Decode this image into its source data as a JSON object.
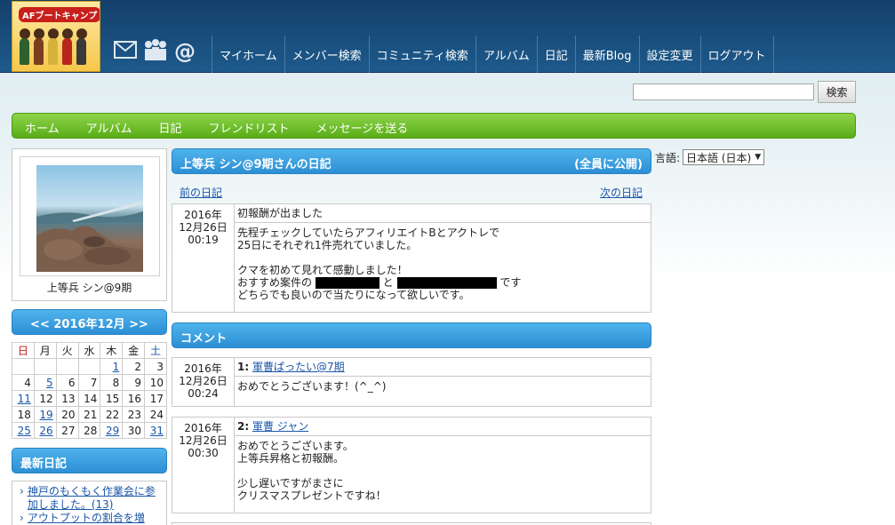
{
  "header": {
    "logo_text": "AFブートキャンプ",
    "icons": [
      "mail-icon",
      "members-icon",
      "at-icon"
    ],
    "nav": [
      "マイホーム",
      "メンバー検索",
      "コミュニティ検索",
      "アルバム",
      "日記",
      "最新Blog",
      "設定変更",
      "ログアウト"
    ]
  },
  "search": {
    "placeholder": "",
    "button": "検索"
  },
  "subnav": [
    "ホーム",
    "アルバム",
    "日記",
    "フレンドリスト",
    "メッセージを送る"
  ],
  "lang": {
    "label": "言語:",
    "selected": "日本語 (日本)"
  },
  "profile": {
    "name": "上等兵 シン@9期"
  },
  "calendar": {
    "title": "<< 2016年12月 >>",
    "dow": [
      "日",
      "月",
      "火",
      "水",
      "木",
      "金",
      "土"
    ],
    "weeks": [
      [
        "",
        "",
        "",
        "",
        "1",
        "2",
        "3"
      ],
      [
        "4",
        "5",
        "6",
        "7",
        "8",
        "9",
        "10"
      ],
      [
        "11",
        "12",
        "13",
        "14",
        "15",
        "16",
        "17"
      ],
      [
        "18",
        "19",
        "20",
        "21",
        "22",
        "23",
        "24"
      ],
      [
        "25",
        "26",
        "27",
        "28",
        "29",
        "30",
        "31"
      ]
    ],
    "linked_days": [
      "1",
      "5",
      "11",
      "19",
      "25",
      "26",
      "29",
      "31"
    ]
  },
  "recent": {
    "title": "最新日記",
    "items": [
      "神戸のもくもく作業会に参加しました。(13)",
      "アウトプットの割合を増"
    ]
  },
  "diary": {
    "title": "上等兵 シン@9期さんの日記",
    "visibility": "(全員に公開)",
    "prev": "前の日記",
    "next": "次の日記",
    "date": [
      "2016年",
      "12月26日",
      "00:19"
    ],
    "subject": "初報酬が出ました",
    "body_line1": "先程チェックしていたらアフィリエイトBとアクトレで",
    "body_line2": "25日にそれぞれ1件売れていました。",
    "body_line3": "クマを初めて見れて感動しました！",
    "body_line4a": "おすすめ案件の",
    "body_line4b": "と",
    "body_line4c": "です",
    "body_line5": "どちらでも良いので当たりになって欲しいです。"
  },
  "comments": {
    "title": "コメント",
    "items": [
      {
        "num": "1:",
        "author": "軍曹ぱったい@7期",
        "date": [
          "2016年",
          "12月26日",
          "00:24"
        ],
        "text": [
          "おめでとうございます！(^_^)"
        ]
      },
      {
        "num": "2:",
        "author": "軍曹 ジャン",
        "date": [
          "2016年",
          "12月26日",
          "00:30"
        ],
        "text": [
          "おめでとうございます。",
          "上等兵昇格と初報酬。",
          "",
          "少し遅いですがまさに",
          "クリスマスプレゼントですね！"
        ]
      }
    ]
  }
}
